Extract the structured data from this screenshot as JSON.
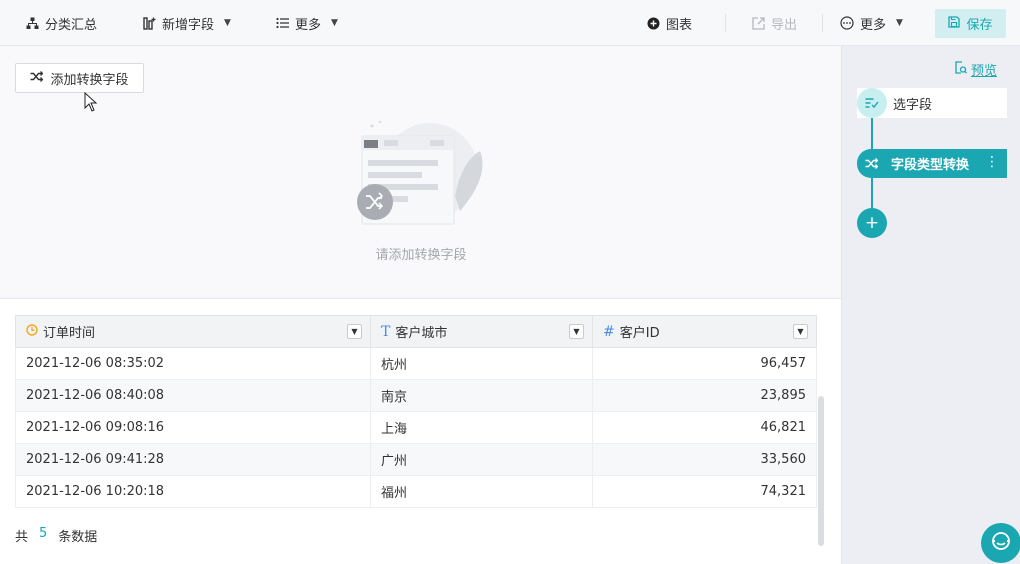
{
  "toolbar": {
    "group_summary": "分类汇总",
    "add_field": "新增字段",
    "more_left": "更多",
    "chart": "图表",
    "export": "导出",
    "more_right": "更多",
    "save": "保存"
  },
  "editor": {
    "add_convert_field": "添加转换字段",
    "empty_hint": "请添加转换字段"
  },
  "grid": {
    "columns": [
      {
        "label": "订单时间",
        "type_icon": "clock-icon",
        "type_color": "#f5a623"
      },
      {
        "label": "客户城市",
        "type_icon": "text-type-icon",
        "type_color": "#4a90e2"
      },
      {
        "label": "客户ID",
        "type_icon": "number-type-icon",
        "type_color": "#4a90e2"
      }
    ],
    "rows": [
      [
        "2021-12-06 08:35:02",
        "杭州",
        "96,457"
      ],
      [
        "2021-12-06 08:40:08",
        "南京",
        "23,895"
      ],
      [
        "2021-12-06 09:08:16",
        "上海",
        "46,821"
      ],
      [
        "2021-12-06 09:41:28",
        "广州",
        "33,560"
      ],
      [
        "2021-12-06 10:20:18",
        "福州",
        "74,321"
      ]
    ],
    "total_prefix": "共",
    "total_count": "5",
    "total_suffix": "条数据"
  },
  "flow": {
    "preview": "预览",
    "select_fields": "选字段",
    "type_convert": "字段类型转换",
    "node_menu": "⋮",
    "add_step": "+"
  },
  "colors": {
    "accent": "#1aa7b1",
    "accent_light": "#d2eef0"
  }
}
